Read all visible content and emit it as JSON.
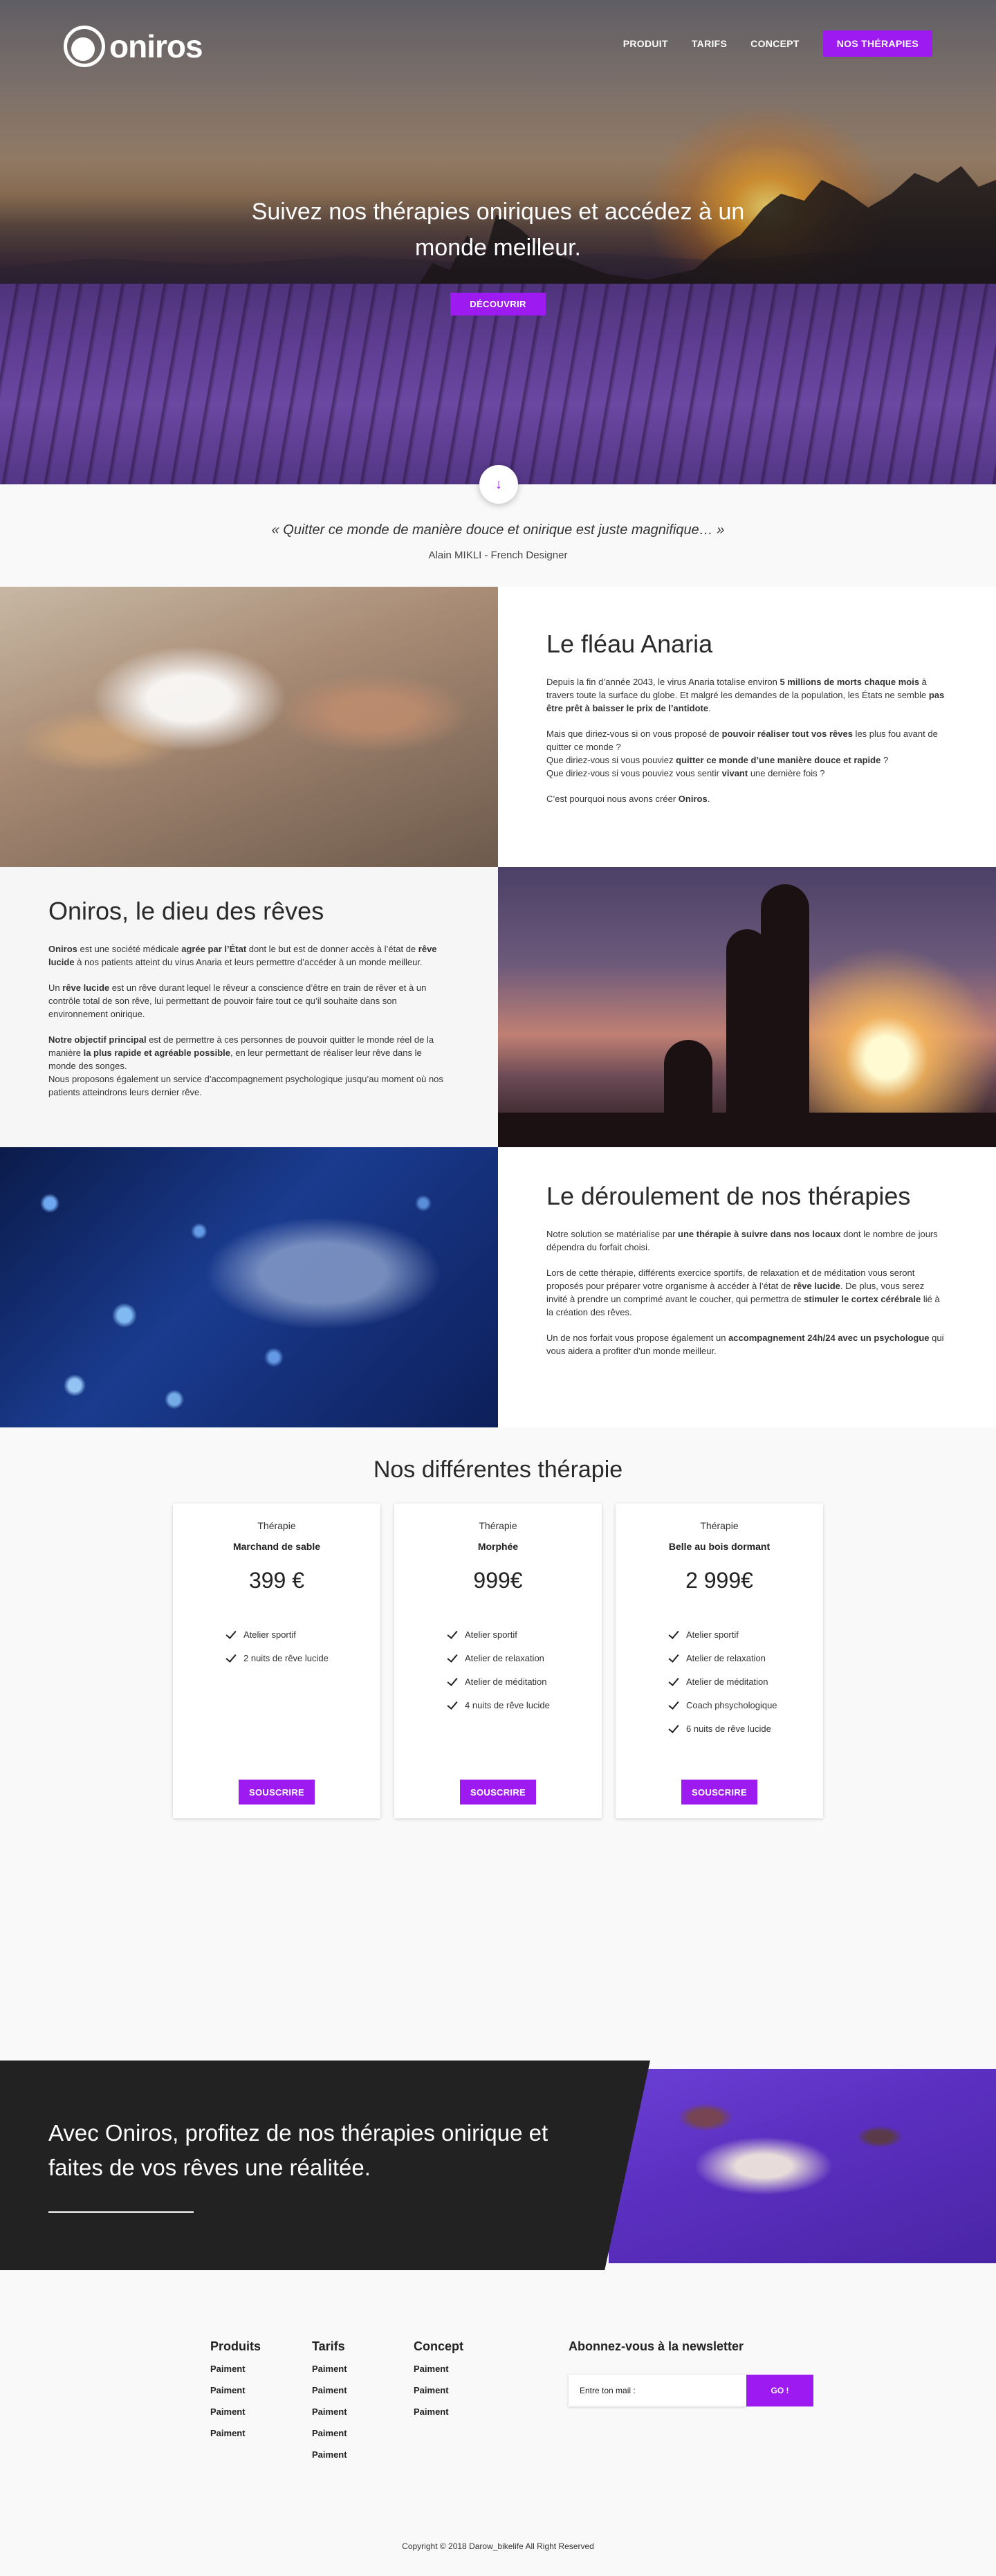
{
  "brand": {
    "name": "oniros",
    "accent": "#9d1bf0",
    "dark": "#222222"
  },
  "nav": {
    "items": [
      "PRODUIT",
      "TARIFS",
      "CONCEPT"
    ],
    "cta": "NOS THÉRAPIES"
  },
  "hero": {
    "title": "Suivez nos thérapies oniriques et accédez à un monde meilleur.",
    "button": "DÉCOUVRIR",
    "scroll_icon": "arrow-down-icon"
  },
  "quote": {
    "text": "« Quitter ce monde de manière douce et onirique est juste magnifique… »",
    "author": "Alain MIKLI - French Designer"
  },
  "sections": [
    {
      "title": "Le fléau Anaria",
      "p1_a": "Depuis la fin d’année 2043, le virus Anaria totalise environ ",
      "p1_b": "5 millions de morts chaque mois",
      "p1_c": " à travers toute la surface du globe. Et malgré les demandes de la population, les États ne semble ",
      "p1_d": "pas être prêt à baisser le prix de l’antidote",
      "p1_e": ".",
      "p2_a": "Mais que diriez-vous si on vous proposé de ",
      "p2_b": "pouvoir réaliser tout vos rêves",
      "p2_c": " les plus fou avant de quitter ce monde ?",
      "p2_d": "Que diriez-vous si vous pouviez ",
      "p2_e": "quitter ce monde d’une manière douce et rapide",
      "p2_f": " ?",
      "p2_g": "Que diriez-vous si vous pouviez vous sentir ",
      "p2_h": "vivant",
      "p2_i": " une dernière fois ?",
      "p3_a": "C’est pourquoi nous avons créer ",
      "p3_b": "Oniros",
      "p3_c": "."
    },
    {
      "title": "Oniros, le dieu des rêves",
      "p1_a": "Oniros",
      "p1_b": " est une société médicale ",
      "p1_c": "agrée par l’État",
      "p1_d": " dont le but est de donner accès à l’état de ",
      "p1_e": "rêve lucide",
      "p1_f": " à nos patients atteint du virus Anaria et leurs permettre d’accéder à un monde meilleur.",
      "p2_a": "Un ",
      "p2_b": "rêve lucide",
      "p2_c": " est un rêve durant lequel le rêveur a conscience d’être en train de rêver et à un contrôle total de son rêve, lui permettant de pouvoir faire tout ce qu’il souhaite dans son environnement onirique.",
      "p3_a": "Notre objectif principal",
      "p3_b": " est de permettre à ces personnes de pouvoir quitter le monde réel de la manière ",
      "p3_c": "la plus rapide et agréable possible",
      "p3_d": ", en leur permettant de réaliser leur rêve dans le monde des songes.",
      "p3_e": "Nous proposons également un service d’accompagnement psychologique jusqu’au moment où nos patients atteindrons leurs dernier rêve."
    },
    {
      "title": "Le déroulement de nos thérapies",
      "p1_a": "Notre solution se matérialise par ",
      "p1_b": "une thérapie à suivre dans nos locaux",
      "p1_c": " dont le nombre de jours dépendra du forfait choisi.",
      "p2_a": "Lors de cette thérapie, différents exercice sportifs, de relaxation et de méditation vous seront proposés pour préparer votre organisme à accéder à l’état de ",
      "p2_b": "rêve lucide",
      "p2_c": ". De plus, vous serez invité à prendre un comprimé avant le coucher, qui permettra de ",
      "p2_d": "stimuler le cortex cérébrale",
      "p2_e": " lié à la création des rêves.",
      "p3_a": "Un de nos forfait vous propose également un ",
      "p3_b": "accompagnement 24h/24 avec un psychologue",
      "p3_c": " qui vous aidera a profiter d’un monde meilleur."
    }
  ],
  "pricing": {
    "title": "Nos différentes thérapie",
    "plans": [
      {
        "kicker": "Thérapie",
        "name": "Marchand de sable",
        "price": "399 €",
        "features": [
          "Atelier sportif",
          "2 nuits de rêve lucide"
        ],
        "button": "SOUSCRIRE"
      },
      {
        "kicker": "Thérapie",
        "name": "Morphée",
        "price": "999€",
        "features": [
          "Atelier sportif",
          "Atelier de relaxation",
          "Atelier de méditation",
          "4 nuits de rêve lucide"
        ],
        "button": "SOUSCRIRE"
      },
      {
        "kicker": "Thérapie",
        "name": "Belle au bois dormant",
        "price": "2 999€",
        "features": [
          "Atelier sportif",
          "Atelier de relaxation",
          "Atelier de méditation",
          "Coach phsychologique",
          "6 nuits de rêve lucide"
        ],
        "button": "SOUSCRIRE"
      }
    ]
  },
  "cta": {
    "text": "Avec Oniros, profitez de nos thérapies onirique et faites de vos rêves une réalitée."
  },
  "footer": {
    "columns": [
      {
        "title": "Produits",
        "links": [
          "Paiment",
          "Paiment",
          "Paiment",
          "Paiment"
        ]
      },
      {
        "title": "Tarifs",
        "links": [
          "Paiment",
          "Paiment",
          "Paiment",
          "Paiment",
          "Paiment"
        ]
      },
      {
        "title": "Concept",
        "links": [
          "Paiment",
          "Paiment",
          "Paiment"
        ]
      }
    ],
    "newsletter": {
      "title": "Abonnez-vous à la newsletter",
      "placeholder": "Entre ton mail :",
      "button": "GO !"
    },
    "copyright": "Copyright © 2018 Darow_bikelife All Right Reserved"
  }
}
